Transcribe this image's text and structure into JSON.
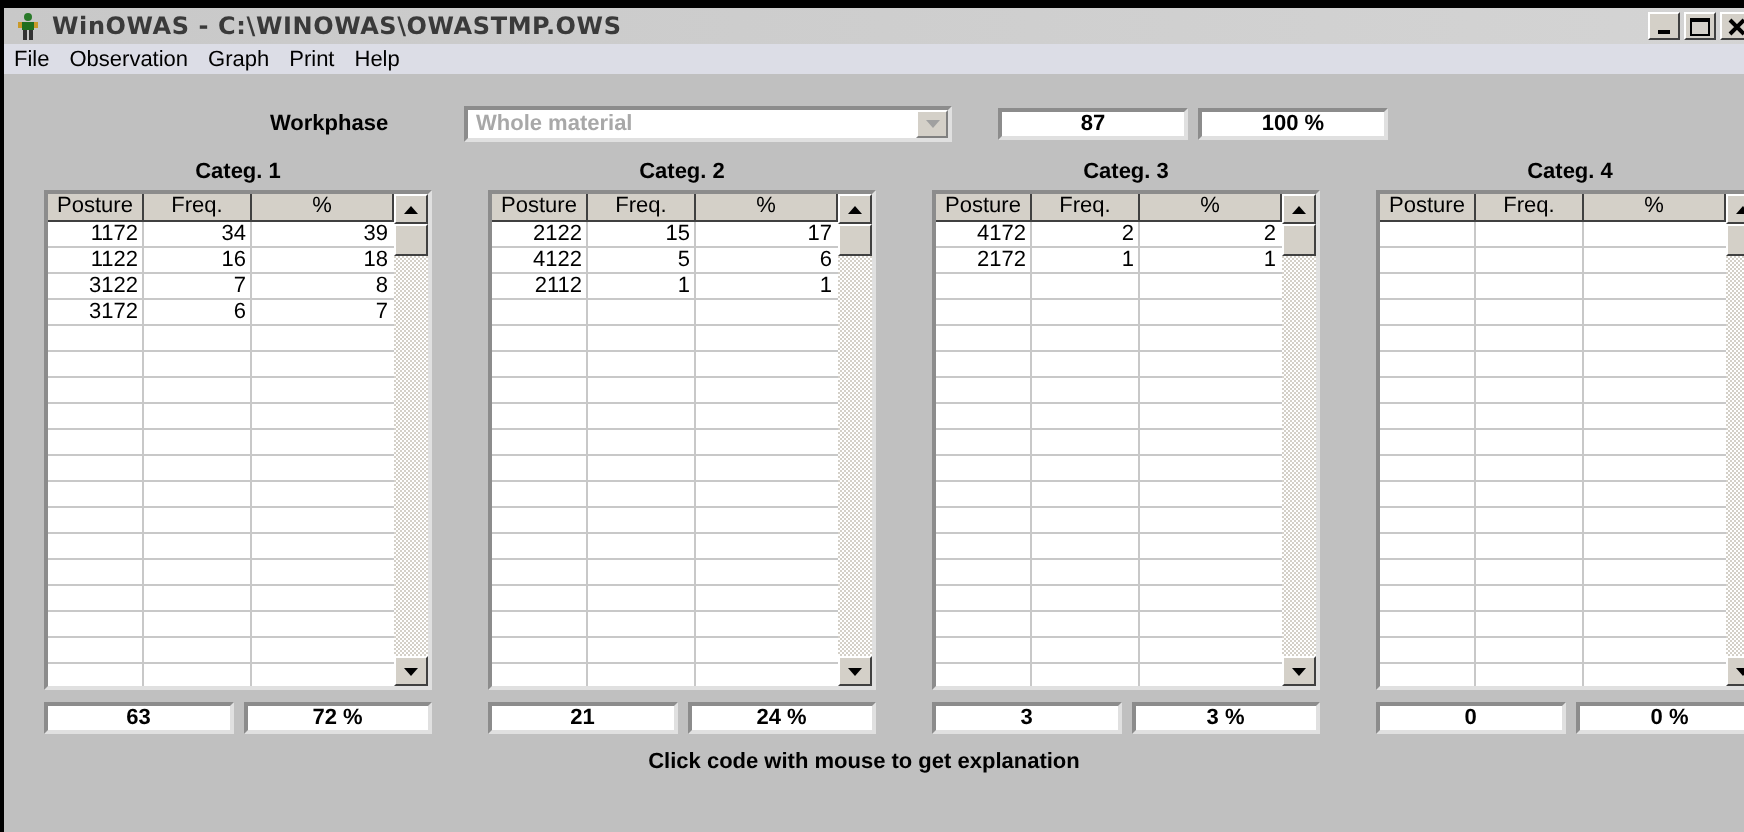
{
  "window": {
    "title": "WinOWAS - C:\\WINOWAS\\OWASTMP.OWS"
  },
  "menu": [
    "File",
    "Observation",
    "Graph",
    "Print",
    "Help"
  ],
  "workphase": {
    "label": "Workphase",
    "value": "Whole material",
    "disabled": true,
    "total": "87",
    "total_percent": "100 %"
  },
  "categories": [
    {
      "title": "Categ. 1",
      "columns": [
        "Posture",
        "Freq.",
        "%"
      ],
      "rows": [
        {
          "posture": "1172",
          "freq": "34",
          "percent": "39"
        },
        {
          "posture": "1122",
          "freq": "16",
          "percent": "18"
        },
        {
          "posture": "3122",
          "freq": "7",
          "percent": "8"
        },
        {
          "posture": "3172",
          "freq": "6",
          "percent": "7"
        }
      ],
      "total": "63",
      "total_percent": "72 %"
    },
    {
      "title": "Categ. 2",
      "columns": [
        "Posture",
        "Freq.",
        "%"
      ],
      "rows": [
        {
          "posture": "2122",
          "freq": "15",
          "percent": "17"
        },
        {
          "posture": "4122",
          "freq": "5",
          "percent": "6"
        },
        {
          "posture": "2112",
          "freq": "1",
          "percent": "1"
        }
      ],
      "total": "21",
      "total_percent": "24 %"
    },
    {
      "title": "Categ. 3",
      "columns": [
        "Posture",
        "Freq.",
        "%"
      ],
      "rows": [
        {
          "posture": "4172",
          "freq": "2",
          "percent": "2"
        },
        {
          "posture": "2172",
          "freq": "1",
          "percent": "1"
        }
      ],
      "total": "3",
      "total_percent": "3 %"
    },
    {
      "title": "Categ. 4",
      "columns": [
        "Posture",
        "Freq.",
        "%"
      ],
      "total": "0",
      "total_percent": "0 %"
    }
  ],
  "hint": "Click code with mouse to get explanation"
}
